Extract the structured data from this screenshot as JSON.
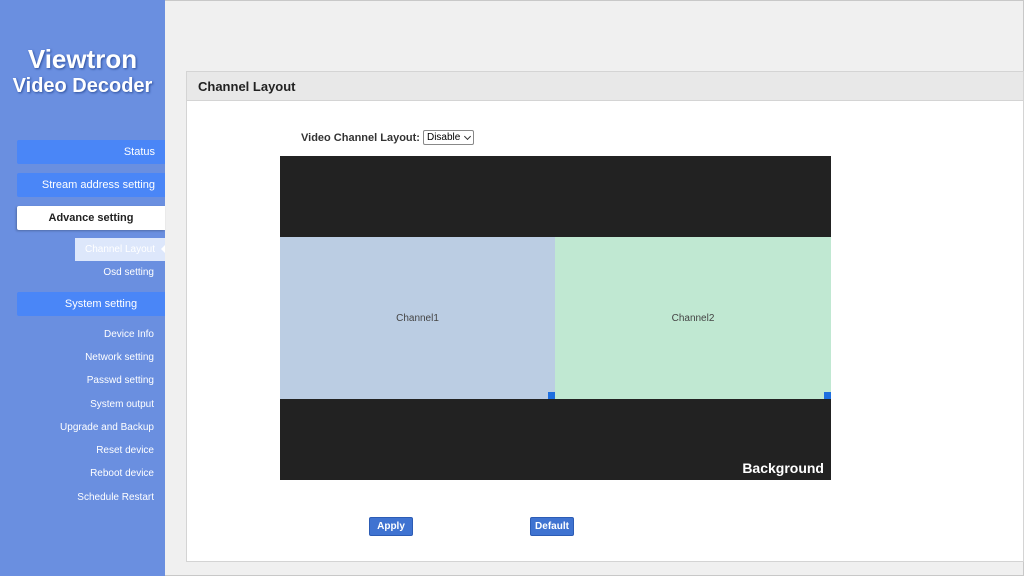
{
  "brand": {
    "line1": "Viewtron",
    "line2": "Video Decoder"
  },
  "nav": {
    "status": "Status",
    "stream": "Stream address setting",
    "advance": "Advance setting",
    "advance_items": [
      "Channel Layout",
      "Osd setting"
    ],
    "system": "System setting",
    "system_items": [
      "Device Info",
      "Network setting",
      "Passwd setting",
      "System output",
      "Upgrade and Backup",
      "Reset device",
      "Reboot device",
      "Schedule Restart"
    ]
  },
  "panel": {
    "title": "Channel Layout",
    "layout_label": "Video Channel Layout:",
    "layout_value": "Disable",
    "channels": [
      "Channel1",
      "Channel2"
    ],
    "background_label": "Background",
    "apply": "Apply",
    "default": "Default"
  },
  "colors": {
    "sidebar": "#6a8fe0",
    "nav_button": "#4a86f7",
    "channel1": "#bbcde3",
    "channel2": "#c0e8d2",
    "canvas": "#222222",
    "action_button": "#3f73d1"
  }
}
